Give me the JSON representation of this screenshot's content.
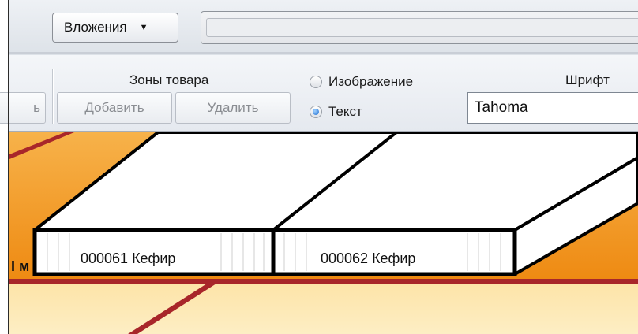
{
  "toolbar": {
    "attachments_label": "Вложения",
    "attachments_arrow": "▼"
  },
  "ribbon": {
    "prev_button_fragment": "ь",
    "zones_title": "Зоны товара",
    "add_button": "Добавить",
    "delete_button": "Удалить",
    "radio_image": "Изображение",
    "radio_text": "Текст",
    "radio_selected": "Текст",
    "font_title": "Шрифт",
    "font_value": "Tahoma"
  },
  "canvas": {
    "shelf_cells": [
      "000061 Кефир",
      "000062 Кефир"
    ],
    "left_fragment": "I м",
    "colors": {
      "orange": "#f39a1e",
      "dark_red": "#a8262a",
      "peach": "#fde7b0"
    }
  }
}
